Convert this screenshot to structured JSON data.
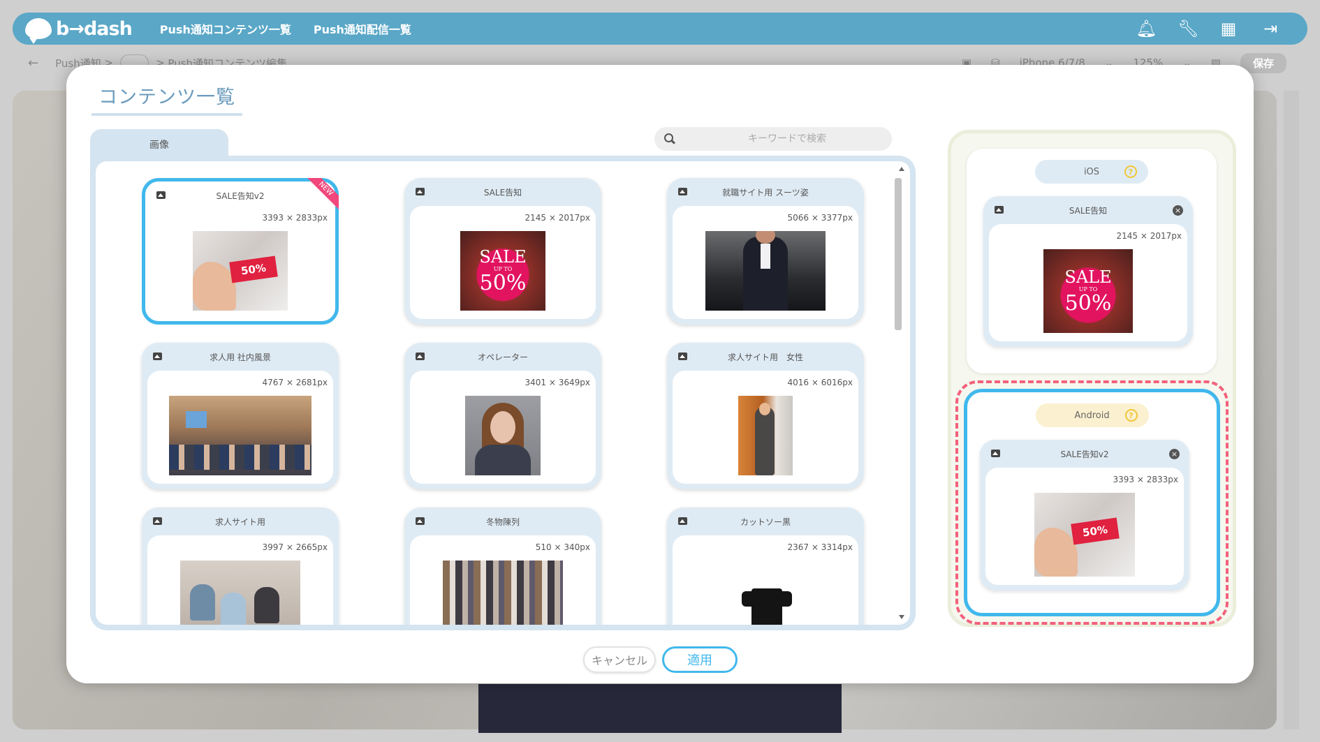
{
  "app": {
    "logo_text": "b→dash",
    "nav": [
      "Push通知コンテンツ一覧",
      "Push通知配信一覧"
    ]
  },
  "subbar": {
    "back_icon": "←",
    "crumbs": [
      "Push通知",
      "…",
      "Push通知コンテンツ編集"
    ],
    "device": "iPhone 6/7/8",
    "zoom": "125%",
    "save_label": "保存"
  },
  "modal": {
    "title": "コンテンツ一覧",
    "tab_label": "画像",
    "search_placeholder": "キーワードで検索",
    "cards": [
      {
        "name": "SALE告知v2",
        "dims": "3393 × 2833px",
        "badge": "NEW"
      },
      {
        "name": "SALE告知",
        "dims": "2145 × 2017px"
      },
      {
        "name": "就職サイト用 スーツ姿",
        "dims": "5066 × 3377px"
      },
      {
        "name": "求人用 社内風景",
        "dims": "4767 × 2681px"
      },
      {
        "name": "オペレーター",
        "dims": "3401 × 3649px"
      },
      {
        "name": "求人サイト用　女性",
        "dims": "4016 × 6016px"
      },
      {
        "name": "求人サイト用",
        "dims": "3997 × 2665px"
      },
      {
        "name": "冬物陳列",
        "dims": "510 × 340px"
      },
      {
        "name": "カットソー黒",
        "dims": "2367 × 3314px"
      }
    ],
    "sale_img": {
      "big": "SALE",
      "small": "UP TO",
      "pct": "50%"
    },
    "tag_text": "50%"
  },
  "preview": {
    "ios": {
      "label": "iOS",
      "help": "?",
      "card_name": "SALE告知",
      "card_dims": "2145 × 2017px",
      "close": "×"
    },
    "android": {
      "label": "Android",
      "help": "?",
      "card_name": "SALE告知v2",
      "card_dims": "3393 × 2833px",
      "close": "×"
    }
  },
  "buttons": {
    "cancel": "キャンセル",
    "apply": "適用"
  },
  "colors": {
    "accent": "#41b8ec",
    "header": "#5aa7c7",
    "android_dash": "#f2617c",
    "new_badge": "#f2477c"
  }
}
